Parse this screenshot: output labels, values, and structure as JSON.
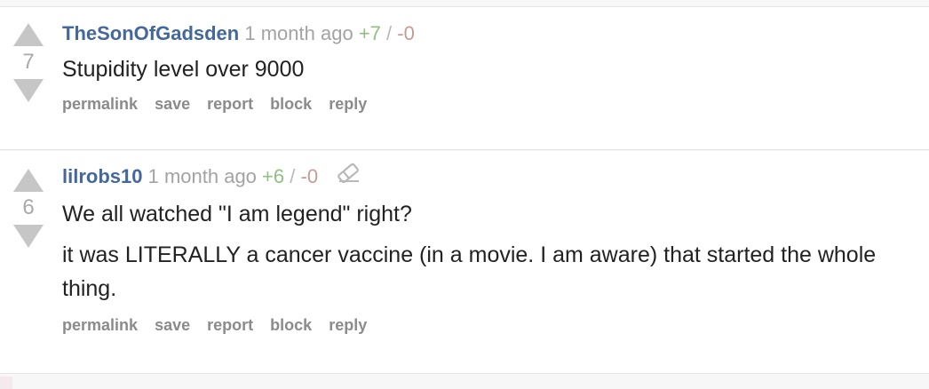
{
  "comments": [
    {
      "score": "7",
      "author": "TheSonOfGadsden",
      "time": "1 month ago",
      "up": "+7",
      "separator": "/",
      "down": "-0",
      "paragraphs": [
        "Stupidity level over 9000"
      ],
      "actions": [
        "permalink",
        "save",
        "report",
        "block",
        "reply"
      ]
    },
    {
      "score": "6",
      "author": "lilrobs10",
      "time": "1 month ago",
      "up": "+6",
      "separator": "/",
      "down": "-0",
      "icon": "eraser-icon",
      "paragraphs": [
        "We all watched \"I am legend\" right?",
        "it was LITERALLY a cancer vaccine (in a movie. I am aware) that started the whole thing."
      ],
      "actions": [
        "permalink",
        "save",
        "report",
        "block",
        "reply"
      ]
    }
  ],
  "colors": {
    "author": "#44689b",
    "upvotes": "#8fbf81",
    "downvotes": "#c69b95",
    "arrows": "#c6c6c6"
  }
}
